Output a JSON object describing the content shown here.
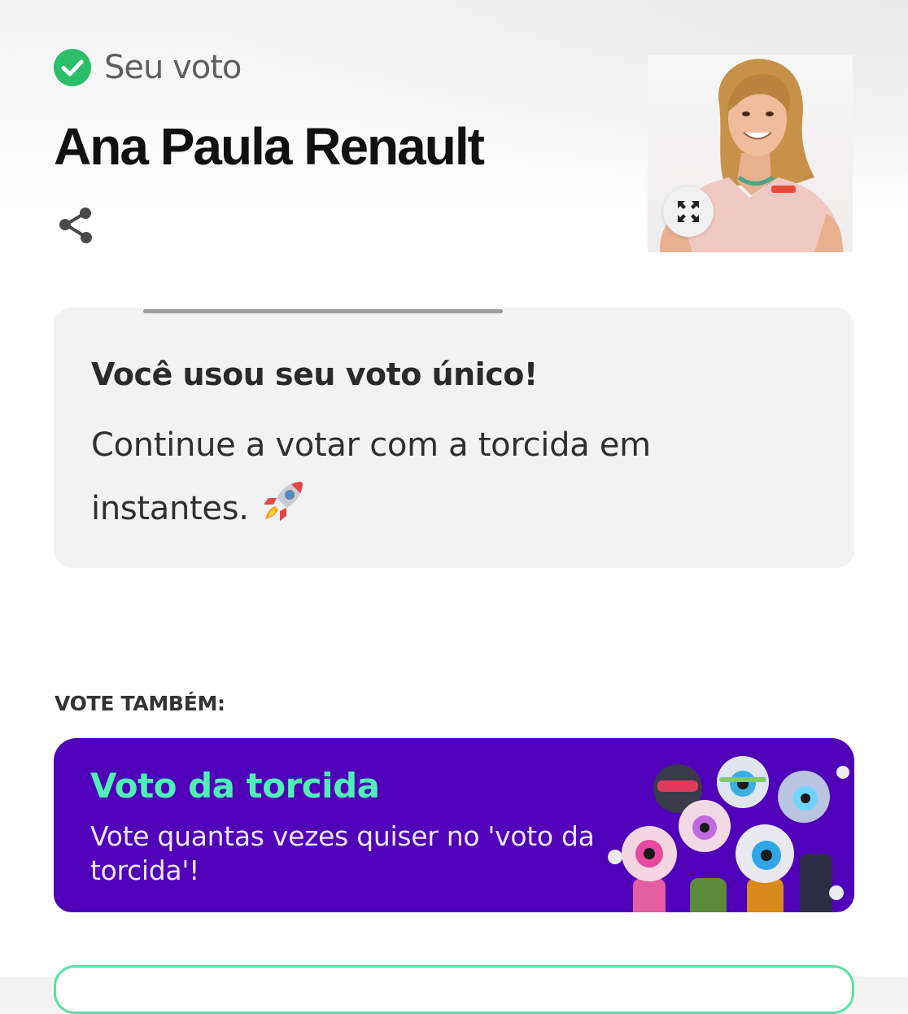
{
  "status": {
    "label": "Seu voto",
    "icon": "check-circle-icon",
    "color": "#2bbf6a"
  },
  "participant": {
    "name": "Ana Paula Renault",
    "share_icon": "share-icon",
    "expand_icon": "expand-icon"
  },
  "info_card": {
    "title": "Você usou seu voto único!",
    "text": "Continue a votar com a torcida em instantes.",
    "emoji": "🚀"
  },
  "vote_also": {
    "label": "VOTE TAMBÉM:"
  },
  "torcida_card": {
    "title": "Voto da torcida",
    "description": "Vote quantas vezes quiser no 'voto da torcida'!",
    "background": "#5000b8",
    "title_color": "#4ff0b4"
  }
}
